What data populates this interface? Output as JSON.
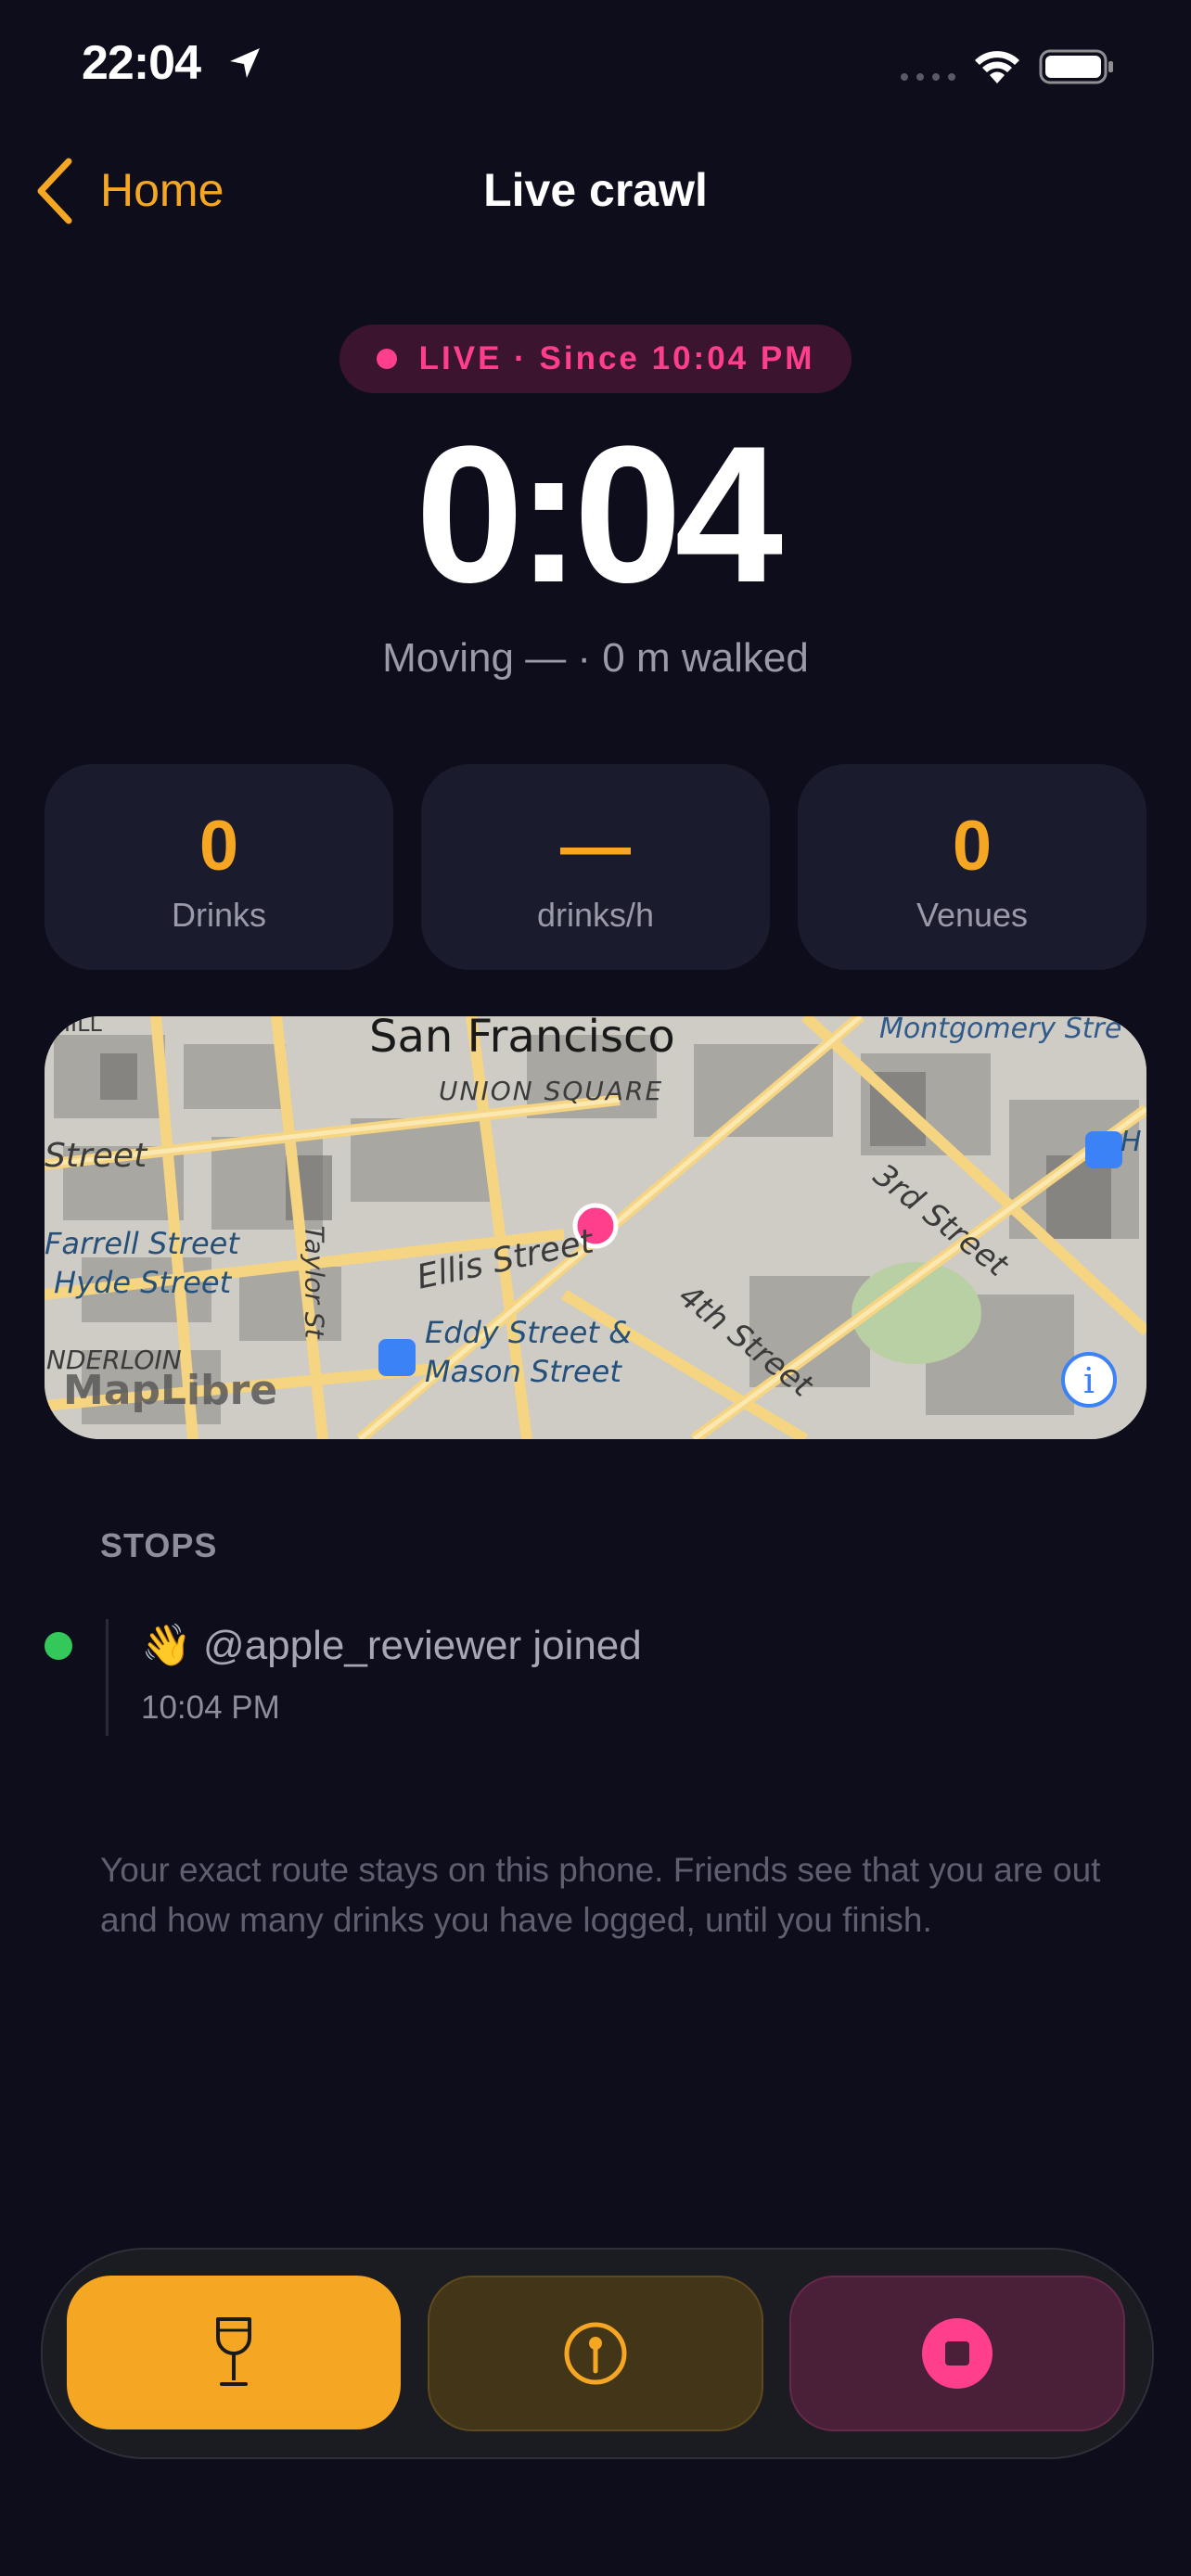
{
  "status_bar": {
    "time": "22:04"
  },
  "nav": {
    "back_label": "Home",
    "title": "Live crawl"
  },
  "live": {
    "label": "LIVE · Since 10:04 PM"
  },
  "timer": "0:04",
  "moving_text": "Moving — · 0 m walked",
  "stats": [
    {
      "value": "0",
      "label": "Drinks"
    },
    {
      "value": "—",
      "label": "drinks/h"
    },
    {
      "value": "0",
      "label": "Venues"
    }
  ],
  "map": {
    "city": "San Francisco",
    "labels": {
      "union_square": "UNION SQUARE",
      "montgomery": "Montgomery Stre",
      "street_left": "Street",
      "hill": "HILL",
      "ofarrell": "Farrell Street",
      "hyde": "Hyde Street",
      "ellis": "Ellis Street",
      "eddy_mason": "Eddy Street &",
      "mason": "Mason Street",
      "fourth": "4th Street",
      "third": "3rd Street",
      "taylor": "Taylor St",
      "tenderloin": "NDERLOIN",
      "h": "H",
      "attribution": "MapLibre"
    },
    "accent": "#ff3f8c"
  },
  "stops": {
    "title": "STOPS",
    "items": [
      {
        "emoji": "👋",
        "text": "@apple_reviewer joined",
        "time": "10:04 PM"
      }
    ]
  },
  "privacy_note": "Your exact route stays on this phone. Friends see that you are out and how many drinks you have logged, until you finish.",
  "actions": [
    {
      "name": "log-drink",
      "icon": "wine-glass-icon"
    },
    {
      "name": "add-venue",
      "icon": "location-pin-icon"
    },
    {
      "name": "stop-crawl",
      "icon": "stop-icon"
    }
  ],
  "colors": {
    "accent": "#f5a623",
    "live": "#ff3f8c",
    "background": "#0d0d1b",
    "card": "#1b1b2e"
  }
}
